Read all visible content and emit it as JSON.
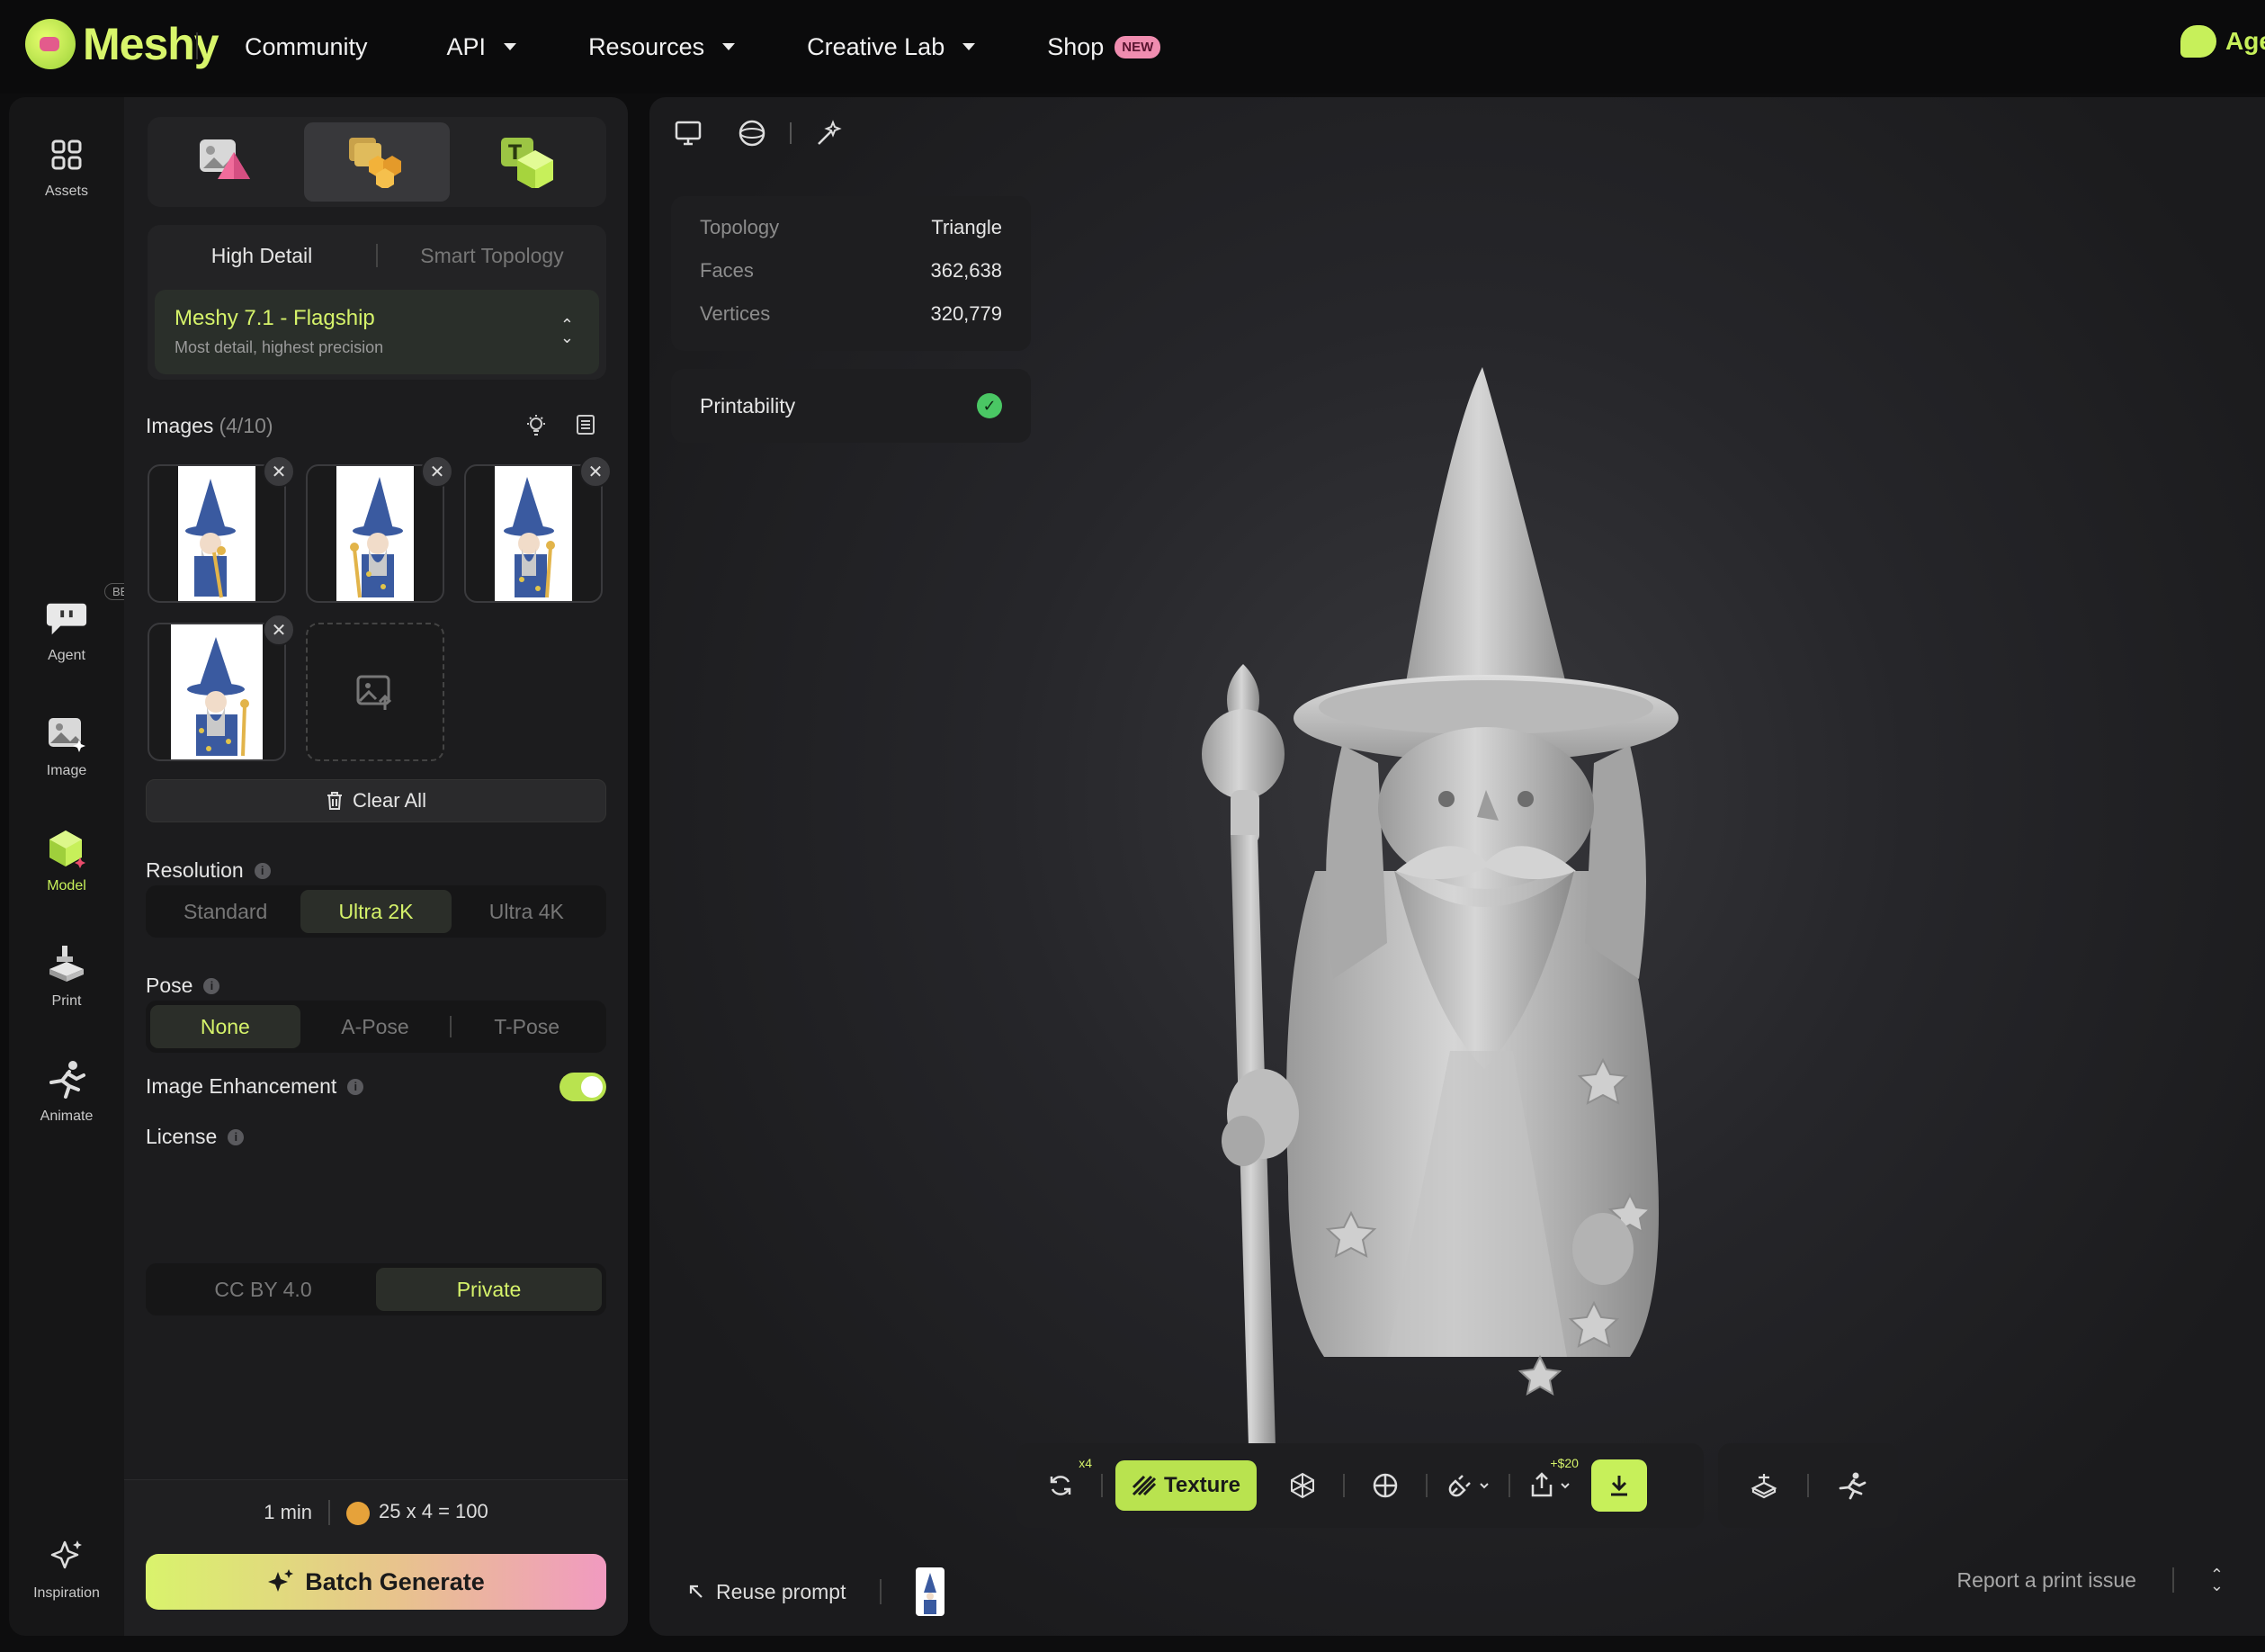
{
  "header": {
    "logo_text": "Meshy",
    "nav": [
      {
        "label": "Community"
      },
      {
        "label": "API"
      },
      {
        "label": "Resources"
      },
      {
        "label": "Creative Lab"
      },
      {
        "label": "Shop",
        "badge": "NEW"
      }
    ],
    "agent_label": "Age"
  },
  "rail": {
    "items": [
      {
        "label": "Assets",
        "icon": "grid-icon"
      },
      {
        "label": "Agent",
        "icon": "agent-bubble-icon",
        "badge": "BETA"
      },
      {
        "label": "Image",
        "icon": "image-sparkle-icon"
      },
      {
        "label": "Model",
        "icon": "cube-icon",
        "active": true
      },
      {
        "label": "Print",
        "icon": "printer-icon"
      },
      {
        "label": "Animate",
        "icon": "running-figure-icon"
      },
      {
        "label": "Inspiration",
        "icon": "sparkles-icon"
      }
    ]
  },
  "panel": {
    "mode_tabs": [
      {
        "icon": "image-to-3d-icon"
      },
      {
        "icon": "multi-image-to-3d-icon",
        "active": true
      },
      {
        "icon": "text-to-3d-icon"
      }
    ],
    "detail_tabs": [
      "High Detail",
      "Smart Topology"
    ],
    "model": {
      "name": "Meshy 7.1 - Flagship",
      "desc": "Most detail, highest precision"
    },
    "images": {
      "title": "Images",
      "count": "(4/10)"
    },
    "clear_all": "Clear All",
    "resolution": {
      "title": "Resolution",
      "options": [
        "Standard",
        "Ultra 2K",
        "Ultra 4K"
      ],
      "selected": "Ultra 2K"
    },
    "pose": {
      "title": "Pose",
      "options": [
        "None",
        "A-Pose",
        "T-Pose"
      ],
      "selected": "None"
    },
    "enhancement": {
      "title": "Image Enhancement",
      "enabled": true
    },
    "license": {
      "title": "License",
      "options": [
        "CC BY 4.0",
        "Private"
      ],
      "selected": "Private"
    },
    "footer": {
      "time": "1 min",
      "cost": "25 x 4 = 100",
      "button": "Batch Generate"
    }
  },
  "viewport": {
    "stats": [
      {
        "key": "Topology",
        "value": "Triangle"
      },
      {
        "key": "Faces",
        "value": "362,638"
      },
      {
        "key": "Vertices",
        "value": "320,779"
      }
    ],
    "printability": "Printability",
    "toolbar": {
      "regen_sup": "x4",
      "texture_label": "Texture",
      "share_sup": "+$20"
    },
    "footer": {
      "reuse": "Reuse prompt",
      "report": "Report a print issue"
    }
  },
  "colors": {
    "accent": "#c7f05a",
    "panel": "#1c1c1e",
    "bg": "#0d0d0e"
  }
}
